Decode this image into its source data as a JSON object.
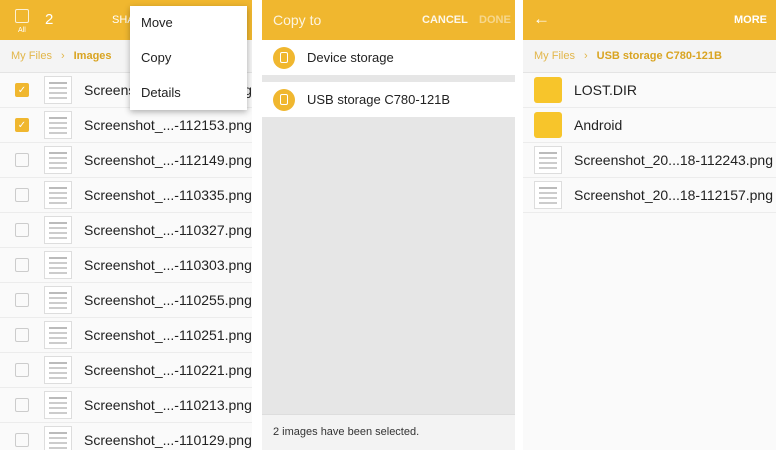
{
  "panel1": {
    "count": "2",
    "all_label": "All",
    "share_label": "SHA",
    "breadcrumb": {
      "root": "My Files",
      "current": "Images"
    },
    "menu": [
      "Move",
      "Copy",
      "Details"
    ],
    "files": [
      {
        "name": "Screenshot_...-112243.png",
        "checked": true
      },
      {
        "name": "Screenshot_...-112153.png",
        "checked": true
      },
      {
        "name": "Screenshot_...-112149.png",
        "checked": false
      },
      {
        "name": "Screenshot_...-110335.png",
        "checked": false
      },
      {
        "name": "Screenshot_...-110327.png",
        "checked": false
      },
      {
        "name": "Screenshot_...-110303.png",
        "checked": false
      },
      {
        "name": "Screenshot_...-110255.png",
        "checked": false
      },
      {
        "name": "Screenshot_...-110251.png",
        "checked": false
      },
      {
        "name": "Screenshot_...-110221.png",
        "checked": false
      },
      {
        "name": "Screenshot_...-110213.png",
        "checked": false
      },
      {
        "name": "Screenshot_...-110129.png",
        "checked": false
      }
    ]
  },
  "panel2": {
    "title": "Copy to",
    "cancel": "CANCEL",
    "done": "DONE",
    "storage": [
      "Device storage",
      "USB storage C780-121B"
    ],
    "status": "2 images have been selected."
  },
  "panel3": {
    "more": "MORE",
    "breadcrumb": {
      "root": "My Files",
      "current": "USB storage C780-121B"
    },
    "items": [
      {
        "name": "LOST.DIR",
        "type": "folder"
      },
      {
        "name": "Android",
        "type": "folder"
      },
      {
        "name": "Screenshot_20...18-112243.png",
        "type": "image"
      },
      {
        "name": "Screenshot_20...18-112157.png",
        "type": "image"
      }
    ]
  }
}
